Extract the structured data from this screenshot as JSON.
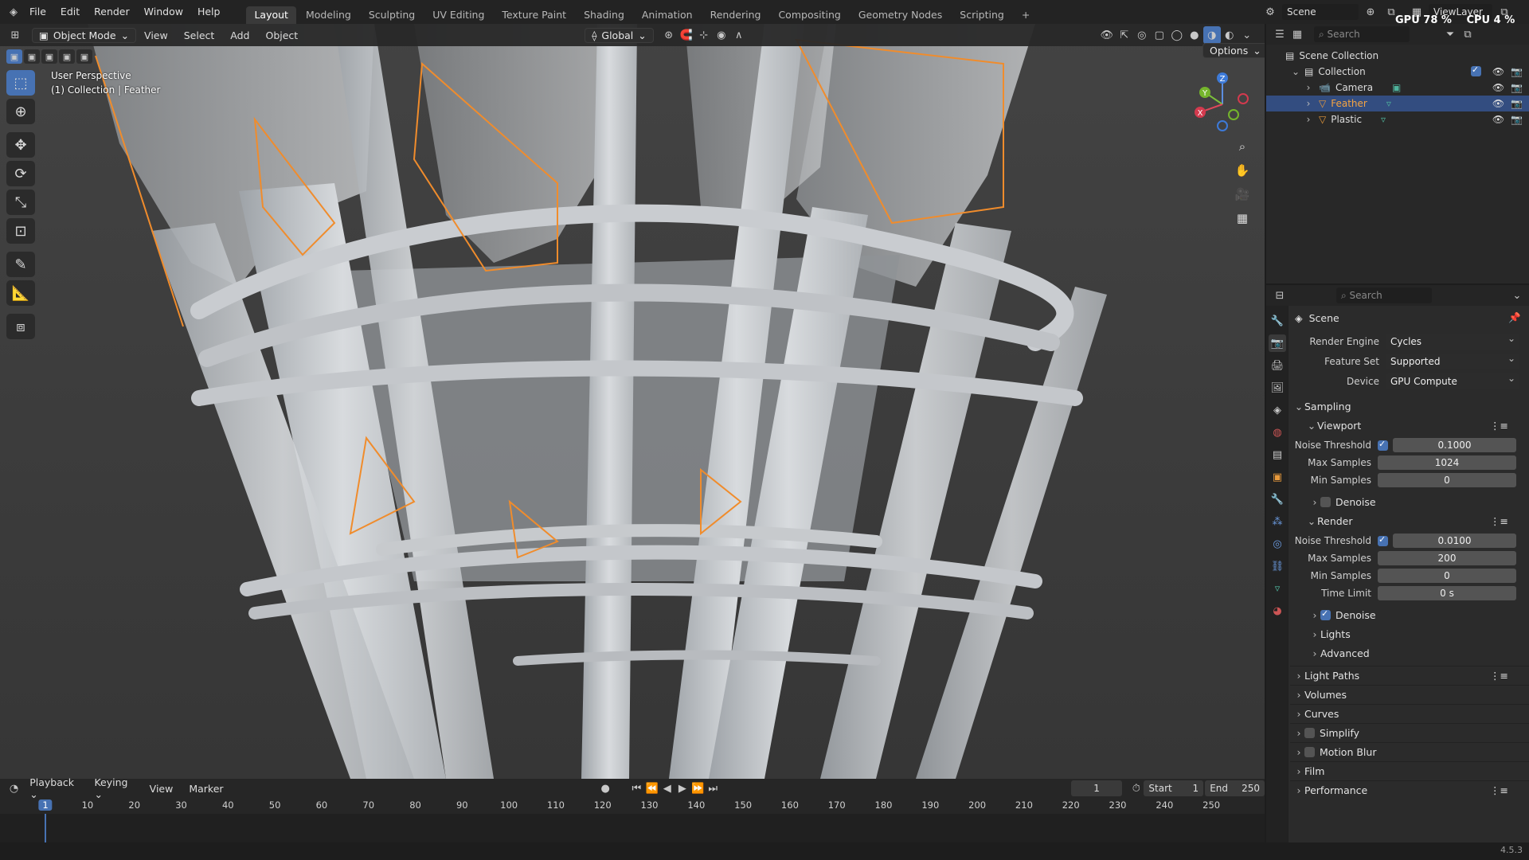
{
  "topbar": {
    "menus": [
      "File",
      "Edit",
      "Render",
      "Window",
      "Help"
    ],
    "workspaces": [
      "Layout",
      "Modeling",
      "Sculpting",
      "UV Editing",
      "Texture Paint",
      "Shading",
      "Animation",
      "Rendering",
      "Compositing",
      "Geometry Nodes",
      "Scripting"
    ],
    "active_workspace": "Layout",
    "scene": "Scene",
    "view_layer": "ViewLayer",
    "gpu_label": "GPU",
    "gpu_value": "78 %",
    "cpu_label": "CPU",
    "cpu_value": "4 %"
  },
  "viewport": {
    "mode": "Object Mode",
    "menus": [
      "View",
      "Select",
      "Add",
      "Object"
    ],
    "orientation": "Global",
    "options_label": "Options",
    "overlay_line1": "User Perspective",
    "overlay_line2": "(1) Collection | Feather",
    "gizmo_axes": [
      "Z",
      "Y",
      "X"
    ]
  },
  "outliner": {
    "search_placeholder": "Search",
    "root": "Scene Collection",
    "collection": "Collection",
    "items": [
      {
        "name": "Camera",
        "selected": false
      },
      {
        "name": "Feather",
        "selected": true
      },
      {
        "name": "Plastic",
        "selected": false
      }
    ]
  },
  "properties": {
    "search_placeholder": "Search",
    "context": "Scene",
    "render_engine_label": "Render Engine",
    "render_engine": "Cycles",
    "feature_set_label": "Feature Set",
    "feature_set": "Supported",
    "device_label": "Device",
    "device": "GPU Compute",
    "sampling": "Sampling",
    "viewport_sec": "Viewport",
    "vp_noise_label": "Noise Threshold",
    "vp_noise": "0.1000",
    "vp_max_label": "Max Samples",
    "vp_max": "1024",
    "vp_min_label": "Min Samples",
    "vp_min": "0",
    "vp_denoise": "Denoise",
    "render_sec": "Render",
    "r_noise_label": "Noise Threshold",
    "r_noise": "0.0100",
    "r_max_label": "Max Samples",
    "r_max": "200",
    "r_min_label": "Min Samples",
    "r_min": "0",
    "r_time_label": "Time Limit",
    "r_time": "0 s",
    "r_denoise": "Denoise",
    "lights": "Lights",
    "advanced": "Advanced",
    "sections": [
      "Light Paths",
      "Volumes",
      "Curves",
      "Simplify",
      "Motion Blur",
      "Film",
      "Performance"
    ]
  },
  "timeline": {
    "menus": [
      "Playback",
      "Keying",
      "View",
      "Marker"
    ],
    "current_frame": "1",
    "start_label": "Start",
    "start": "1",
    "end_label": "End",
    "end": "250",
    "ticks": [
      "1",
      "10",
      "20",
      "30",
      "40",
      "50",
      "60",
      "70",
      "80",
      "90",
      "100",
      "110",
      "120",
      "130",
      "140",
      "150",
      "160",
      "170",
      "180",
      "190",
      "200",
      "210",
      "220",
      "230",
      "240",
      "250"
    ]
  },
  "status": {
    "version": "4.5.3"
  },
  "colors": {
    "accent": "#4772b3",
    "selection": "#f08c2c",
    "active_tab": "#3a3a3a"
  }
}
